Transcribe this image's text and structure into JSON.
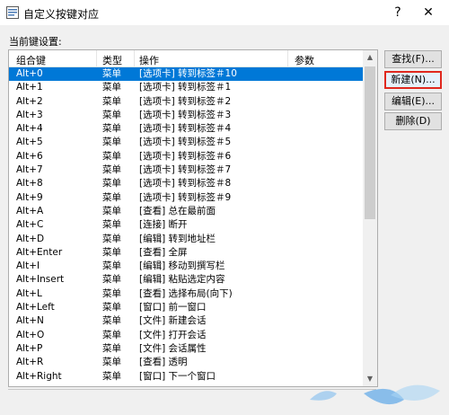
{
  "window": {
    "title": "自定义按键对应",
    "help_label": "?",
    "close_label": "✕"
  },
  "section_label": "当前键设置:",
  "columns": [
    "组合键",
    "类型",
    "操作",
    "参数"
  ],
  "rows": [
    {
      "key": "Alt+0",
      "type": "菜单",
      "op": "[选项卡] 转到标签＃10",
      "param": "",
      "selected": true
    },
    {
      "key": "Alt+1",
      "type": "菜单",
      "op": "[选项卡] 转到标签＃1",
      "param": ""
    },
    {
      "key": "Alt+2",
      "type": "菜单",
      "op": "[选项卡] 转到标签＃2",
      "param": ""
    },
    {
      "key": "Alt+3",
      "type": "菜单",
      "op": "[选项卡] 转到标签＃3",
      "param": ""
    },
    {
      "key": "Alt+4",
      "type": "菜单",
      "op": "[选项卡] 转到标签＃4",
      "param": ""
    },
    {
      "key": "Alt+5",
      "type": "菜单",
      "op": "[选项卡] 转到标签＃5",
      "param": ""
    },
    {
      "key": "Alt+6",
      "type": "菜单",
      "op": "[选项卡] 转到标签＃6",
      "param": ""
    },
    {
      "key": "Alt+7",
      "type": "菜单",
      "op": "[选项卡] 转到标签＃7",
      "param": ""
    },
    {
      "key": "Alt+8",
      "type": "菜单",
      "op": "[选项卡] 转到标签＃8",
      "param": ""
    },
    {
      "key": "Alt+9",
      "type": "菜单",
      "op": "[选项卡] 转到标签＃9",
      "param": ""
    },
    {
      "key": "Alt+A",
      "type": "菜单",
      "op": "[查看] 总在最前面",
      "param": ""
    },
    {
      "key": "Alt+C",
      "type": "菜单",
      "op": "[连接] 断开",
      "param": ""
    },
    {
      "key": "Alt+D",
      "type": "菜单",
      "op": "[编辑] 转到地址栏",
      "param": ""
    },
    {
      "key": "Alt+Enter",
      "type": "菜单",
      "op": "[查看] 全屏",
      "param": ""
    },
    {
      "key": "Alt+I",
      "type": "菜单",
      "op": "[编辑] 移动到撰写栏",
      "param": ""
    },
    {
      "key": "Alt+Insert",
      "type": "菜单",
      "op": "[编辑] 粘贴选定内容",
      "param": ""
    },
    {
      "key": "Alt+L",
      "type": "菜单",
      "op": "[查看] 选择布局(向下)",
      "param": ""
    },
    {
      "key": "Alt+Left",
      "type": "菜单",
      "op": "[窗口] 前一窗口",
      "param": ""
    },
    {
      "key": "Alt+N",
      "type": "菜单",
      "op": "[文件] 新建会话",
      "param": ""
    },
    {
      "key": "Alt+O",
      "type": "菜单",
      "op": "[文件] 打开会话",
      "param": ""
    },
    {
      "key": "Alt+P",
      "type": "菜单",
      "op": "[文件] 会话属性",
      "param": ""
    },
    {
      "key": "Alt+R",
      "type": "菜单",
      "op": "[查看] 透明",
      "param": ""
    },
    {
      "key": "Alt+Right",
      "type": "菜单",
      "op": "[窗口] 下一个窗口",
      "param": ""
    }
  ],
  "buttons": {
    "find": "查找(F)...",
    "new": "新建(N)...",
    "edit": "编辑(E)...",
    "delete": "删除(D)"
  },
  "colors": {
    "selection": "#0078d7",
    "highlight_border": "#e0281e"
  }
}
